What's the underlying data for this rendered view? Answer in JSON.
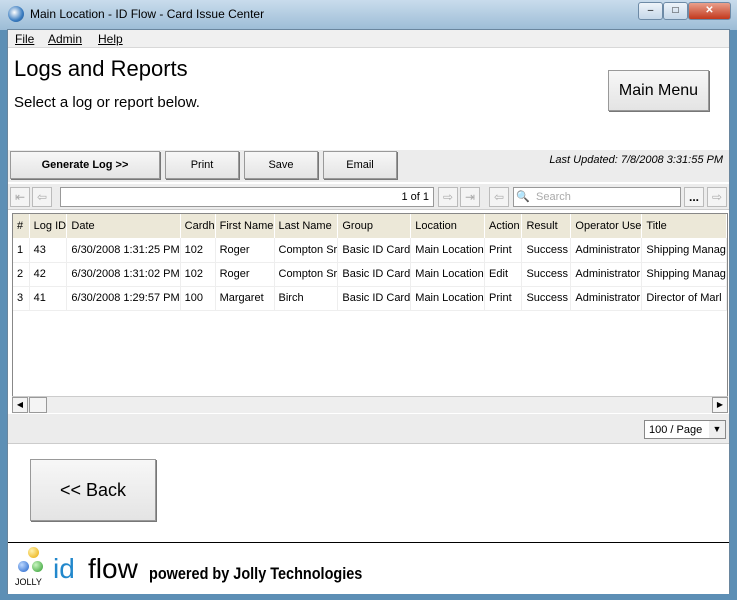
{
  "window": {
    "title": "Main Location - ID Flow - Card Issue Center",
    "min": "–",
    "max": "□",
    "close": "✕"
  },
  "menu": [
    "File",
    "Admin",
    "Help"
  ],
  "page": {
    "heading": "Logs and Reports",
    "subtitle": "Select a log or report below.",
    "main_menu": "Main Menu",
    "last_updated": "Last Updated: 7/8/2008 3:31:55 PM",
    "back": "<< Back"
  },
  "toolbar": {
    "generate": "Generate Log >>",
    "print": "Print",
    "save": "Save",
    "email": "Email"
  },
  "nav": {
    "page_indicator": "1 of 1",
    "search_placeholder": "Search",
    "more": "..."
  },
  "table": {
    "columns": [
      "#",
      "Log ID",
      "Date",
      "Cardh",
      "First Name",
      "Last Name",
      "Group",
      "Location",
      "Action",
      "Result",
      "Operator Use",
      "Title"
    ],
    "rows": [
      [
        "1",
        "43",
        "6/30/2008 1:31:25 PM",
        "102",
        "Roger",
        "Compton Sr",
        "Basic ID Card",
        "Main Location",
        "Print",
        "Success",
        "Administrator",
        "Shipping Manag"
      ],
      [
        "2",
        "42",
        "6/30/2008 1:31:02 PM",
        "102",
        "Roger",
        "Compton Sr",
        "Basic ID Card",
        "Main Location",
        "Edit",
        "Success",
        "Administrator",
        "Shipping Manag"
      ],
      [
        "3",
        "41",
        "6/30/2008 1:29:57 PM",
        "100",
        "Margaret",
        "Birch",
        "Basic ID Card",
        "Main Location",
        "Print",
        "Success",
        "Administrator",
        "Director of Marl"
      ]
    ]
  },
  "pager": {
    "page_size": "100 / Page"
  },
  "footer": {
    "logo_text": "JOLLY",
    "id": "id",
    "flow": "flow",
    "powered": "powered by Jolly Technologies"
  }
}
